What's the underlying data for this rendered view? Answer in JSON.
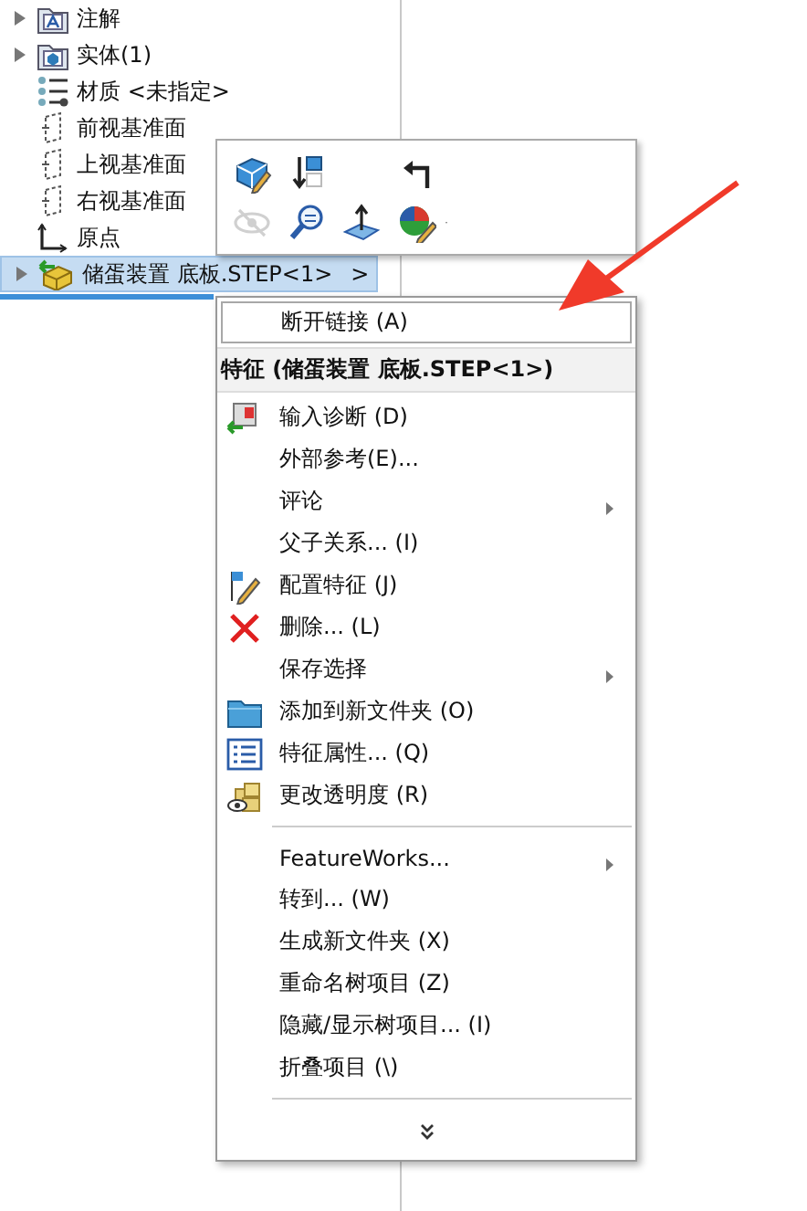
{
  "tree": {
    "items": [
      {
        "label": "注解",
        "expandable": true,
        "selected": false
      },
      {
        "label": "实体(1)",
        "expandable": true,
        "selected": false
      },
      {
        "label": "材质 <未指定>",
        "expandable": false,
        "selected": false
      },
      {
        "label": "前视基准面",
        "expandable": false,
        "selected": false
      },
      {
        "label": "上视基准面",
        "expandable": false,
        "selected": false
      },
      {
        "label": "右视基准面",
        "expandable": false,
        "selected": false
      },
      {
        "label": "原点",
        "expandable": false,
        "selected": false
      },
      {
        "label": "储蛋装置 底板.STEP<1>",
        "suffix": ">",
        "expandable": true,
        "selected": true
      }
    ]
  },
  "toolbar": {
    "buttons": [
      {
        "disabled": false
      },
      {
        "disabled": false
      },
      {
        "disabled": false
      },
      {
        "disabled": true
      },
      {
        "disabled": false
      },
      {
        "disabled": false
      },
      {
        "disabled": false
      }
    ]
  },
  "menu": {
    "top_item": {
      "label": "断开链接 (A)",
      "hovered": true
    },
    "title": "特征 (储蛋装置 底板.STEP<1>)",
    "items": [
      {
        "kind": "item",
        "label": "输入诊断 (D)",
        "submenu": false
      },
      {
        "kind": "item",
        "label": "外部参考(E)...",
        "submenu": false
      },
      {
        "kind": "item",
        "label": "评论",
        "submenu": true
      },
      {
        "kind": "item",
        "label": "父子关系... (I)",
        "submenu": false
      },
      {
        "kind": "item",
        "label": "配置特征 (J)",
        "submenu": false
      },
      {
        "kind": "item",
        "label": "删除... (L)",
        "submenu": false
      },
      {
        "kind": "item",
        "label": "保存选择",
        "submenu": true
      },
      {
        "kind": "item",
        "label": "添加到新文件夹 (O)",
        "submenu": false
      },
      {
        "kind": "item",
        "label": "特征属性... (Q)",
        "submenu": false
      },
      {
        "kind": "item",
        "label": "更改透明度 (R)",
        "submenu": false
      },
      {
        "kind": "separator"
      },
      {
        "kind": "item",
        "label": "FeatureWorks...",
        "submenu": true
      },
      {
        "kind": "item",
        "label": "转到... (W)",
        "submenu": false
      },
      {
        "kind": "item",
        "label": "生成新文件夹 (X)",
        "submenu": false
      },
      {
        "kind": "item",
        "label": "重命名树项目 (Z)",
        "submenu": false
      },
      {
        "kind": "item",
        "label": "隐藏/显示树项目... (I)",
        "submenu": false
      },
      {
        "kind": "item",
        "label": "折叠项目 (\\)",
        "submenu": false
      },
      {
        "kind": "separator"
      },
      {
        "kind": "more"
      }
    ]
  },
  "annotation_arrow": true
}
